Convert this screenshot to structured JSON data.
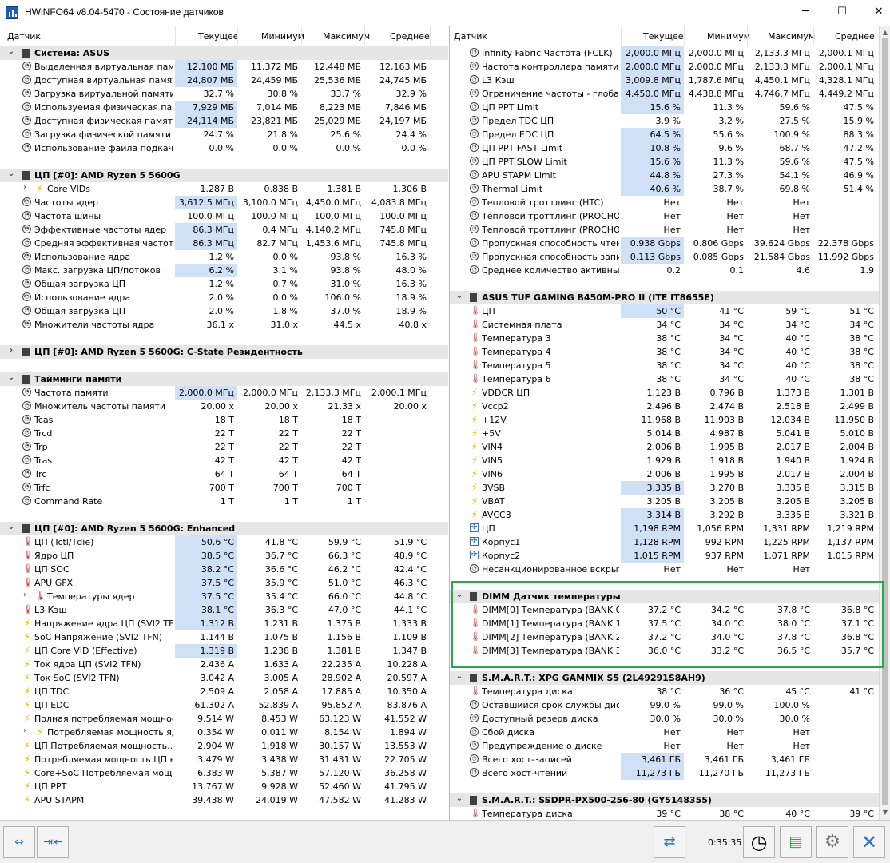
{
  "window": {
    "title": "HWiNFO64 v8.04-5470 - Состояние датчиков"
  },
  "columns": {
    "sensor": "Датчик",
    "current": "Текущее",
    "min": "Минимум",
    "max": "Максимум",
    "avg": "Среднее"
  },
  "left_rows": [
    {
      "type": "group",
      "exp": "⌄",
      "icon": "chip",
      "label": "Система: ASUS"
    },
    {
      "icon": "clock",
      "label": "Выделенная виртуальная память",
      "cur": "12,100 МБ",
      "min": "11,372 МБ",
      "max": "12,448 МБ",
      "avg": "12,163 МБ",
      "hl": true
    },
    {
      "icon": "clock",
      "label": "Доступная виртуальная память",
      "cur": "24,807 МБ",
      "min": "24,459 МБ",
      "max": "25,536 МБ",
      "avg": "24,745 МБ",
      "hl": true
    },
    {
      "icon": "clock",
      "label": "Загрузка виртуальной памяти",
      "cur": "32.7 %",
      "min": "30.8 %",
      "max": "33.7 %",
      "avg": "32.9 %"
    },
    {
      "icon": "clock",
      "label": "Используемая физическая память",
      "cur": "7,929 МБ",
      "min": "7,014 МБ",
      "max": "8,223 МБ",
      "avg": "7,846 МБ",
      "hl": true
    },
    {
      "icon": "clock",
      "label": "Доступная физическая память",
      "cur": "24,114 МБ",
      "min": "23,821 МБ",
      "max": "25,029 МБ",
      "avg": "24,197 МБ",
      "hl": true
    },
    {
      "icon": "clock",
      "label": "Загрузка физической памяти",
      "cur": "24.7 %",
      "min": "21.8 %",
      "max": "25.6 %",
      "avg": "24.4 %"
    },
    {
      "icon": "clock",
      "label": "Использование файла подкачки",
      "cur": "0.0 %",
      "min": "0.0 %",
      "max": "0.0 %",
      "avg": "0.0 %"
    },
    {
      "type": "spacer"
    },
    {
      "type": "group",
      "exp": "⌄",
      "icon": "chip",
      "label": "ЦП [#0]: AMD Ryzen 5 5600G"
    },
    {
      "exp": "›",
      "indent": 1,
      "icon": "bolt",
      "label": "Core VIDs",
      "cur": "1.287 В",
      "min": "0.838 В",
      "max": "1.381 В",
      "avg": "1.306 В"
    },
    {
      "exp": "›",
      "icon": "clock",
      "label": "Частоты ядер",
      "cur": "3,612.5 МГц",
      "min": "3,100.0 МГц",
      "max": "4,450.0 МГц",
      "avg": "4,083.8 МГц",
      "hl": true
    },
    {
      "icon": "clock",
      "label": "Частота шины",
      "cur": "100.0 МГц",
      "min": "100.0 МГц",
      "max": "100.0 МГц",
      "avg": "100.0 МГц"
    },
    {
      "exp": "›",
      "icon": "clock",
      "label": "Эффективные частоты ядер",
      "cur": "86.3 МГц",
      "min": "0.4 МГц",
      "max": "4,140.2 МГц",
      "avg": "745.8 МГц",
      "hl": true
    },
    {
      "icon": "clock",
      "label": "Средняя эффективная частота",
      "cur": "86.3 МГц",
      "min": "82.7 МГц",
      "max": "1,453.6 МГц",
      "avg": "745.8 МГц",
      "hl": true
    },
    {
      "exp": "›",
      "icon": "clock",
      "label": "Использование ядра",
      "cur": "1.2 %",
      "min": "0.0 %",
      "max": "93.8 %",
      "avg": "16.3 %"
    },
    {
      "icon": "clock",
      "label": "Макс. загрузка ЦП/потоков",
      "cur": "6.2 %",
      "min": "3.1 %",
      "max": "93.8 %",
      "avg": "48.0 %",
      "hl": true
    },
    {
      "icon": "clock",
      "label": "Общая загрузка ЦП",
      "cur": "1.2 %",
      "min": "0.7 %",
      "max": "31.0 %",
      "avg": "16.3 %"
    },
    {
      "exp": "›",
      "icon": "clock",
      "label": "Использование ядра",
      "cur": "2.0 %",
      "min": "0.0 %",
      "max": "106.0 %",
      "avg": "18.9 %"
    },
    {
      "icon": "clock",
      "label": "Общая загрузка ЦП",
      "cur": "2.0 %",
      "min": "1.8 %",
      "max": "37.0 %",
      "avg": "18.9 %"
    },
    {
      "exp": "›",
      "icon": "clock",
      "label": "Множители частоты ядра",
      "cur": "36.1 x",
      "min": "31.0 x",
      "max": "44.5 x",
      "avg": "40.8 x"
    },
    {
      "type": "spacer"
    },
    {
      "type": "group",
      "exp": "›",
      "icon": "chip",
      "label": "ЦП [#0]: AMD Ryzen 5 5600G: C-State Резидентность"
    },
    {
      "type": "spacer"
    },
    {
      "type": "group",
      "exp": "⌄",
      "icon": "chip",
      "label": "Тайминги памяти"
    },
    {
      "icon": "clock",
      "label": "Частота памяти",
      "cur": "2,000.0 МГц",
      "min": "2,000.0 МГц",
      "max": "2,133.3 МГц",
      "avg": "2,000.1 МГц",
      "hl": true
    },
    {
      "icon": "clock",
      "label": "Множитель частоты памяти",
      "cur": "20.00 x",
      "min": "20.00 x",
      "max": "21.33 x",
      "avg": "20.00 x"
    },
    {
      "icon": "clock",
      "label": "Tcas",
      "cur": "18 T",
      "min": "18 T",
      "max": "18 T",
      "avg": ""
    },
    {
      "icon": "clock",
      "label": "Trcd",
      "cur": "22 T",
      "min": "22 T",
      "max": "22 T",
      "avg": ""
    },
    {
      "icon": "clock",
      "label": "Trp",
      "cur": "22 T",
      "min": "22 T",
      "max": "22 T",
      "avg": ""
    },
    {
      "icon": "clock",
      "label": "Tras",
      "cur": "42 T",
      "min": "42 T",
      "max": "42 T",
      "avg": ""
    },
    {
      "icon": "clock",
      "label": "Trc",
      "cur": "64 T",
      "min": "64 T",
      "max": "64 T",
      "avg": ""
    },
    {
      "icon": "clock",
      "label": "Trfc",
      "cur": "700 T",
      "min": "700 T",
      "max": "700 T",
      "avg": ""
    },
    {
      "icon": "clock",
      "label": "Command Rate",
      "cur": "1 T",
      "min": "1 T",
      "max": "1 T",
      "avg": ""
    },
    {
      "type": "spacer"
    },
    {
      "type": "group",
      "exp": "⌄",
      "icon": "chip",
      "label": "ЦП [#0]: AMD Ryzen 5 5600G: Enhanced"
    },
    {
      "icon": "therm",
      "label": "ЦП (Tctl/Tdie)",
      "cur": "50.6 °C",
      "min": "41.8 °C",
      "max": "59.9 °C",
      "avg": "51.9 °C",
      "hl": true
    },
    {
      "icon": "therm",
      "label": "Ядро ЦП",
      "cur": "38.5 °C",
      "min": "36.7 °C",
      "max": "66.3 °C",
      "avg": "48.9 °C",
      "hl": true
    },
    {
      "icon": "therm",
      "label": "ЦП SOC",
      "cur": "38.2 °C",
      "min": "36.6 °C",
      "max": "46.2 °C",
      "avg": "42.4 °C",
      "hl": true
    },
    {
      "icon": "therm",
      "label": "APU GFX",
      "cur": "37.5 °C",
      "min": "35.9 °C",
      "max": "51.0 °C",
      "avg": "46.3 °C",
      "hl": true
    },
    {
      "exp": "›",
      "indent": 1,
      "icon": "therm",
      "label": "Температуры ядер",
      "cur": "37.5 °C",
      "min": "35.4 °C",
      "max": "66.0 °C",
      "avg": "44.8 °C",
      "hl": true
    },
    {
      "icon": "therm",
      "label": "L3 Кэш",
      "cur": "38.1 °C",
      "min": "36.3 °C",
      "max": "47.0 °C",
      "avg": "44.1 °C",
      "hl": true
    },
    {
      "icon": "bolt",
      "label": "Напряжение ядра ЦП (SVI2 TFN)",
      "cur": "1.312 В",
      "min": "1.231 В",
      "max": "1.375 В",
      "avg": "1.333 В",
      "hl": true
    },
    {
      "icon": "bolt",
      "label": "SoC Напряжение (SVI2 TFN)",
      "cur": "1.144 В",
      "min": "1.075 В",
      "max": "1.156 В",
      "avg": "1.109 В"
    },
    {
      "icon": "bolt",
      "label": "ЦП Core VID (Effective)",
      "cur": "1.319 В",
      "min": "1.238 В",
      "max": "1.381 В",
      "avg": "1.347 В",
      "hl": true
    },
    {
      "icon": "bolt",
      "label": "Ток ядра ЦП (SVI2 TFN)",
      "cur": "2.436 A",
      "min": "1.633 A",
      "max": "22.235 A",
      "avg": "10.228 A"
    },
    {
      "icon": "bolt",
      "label": "Ток SoC (SVI2 TFN)",
      "cur": "3.042 A",
      "min": "3.005 A",
      "max": "28.902 A",
      "avg": "20.597 A"
    },
    {
      "icon": "bolt",
      "label": "ЦП TDC",
      "cur": "2.509 A",
      "min": "2.058 A",
      "max": "17.885 A",
      "avg": "10.350 A"
    },
    {
      "icon": "bolt",
      "label": "ЦП EDC",
      "cur": "61.302 A",
      "min": "52.839 A",
      "max": "95.852 A",
      "avg": "83.876 A"
    },
    {
      "icon": "bolt",
      "label": "Полная потребляемая мощност...",
      "cur": "9.514 W",
      "min": "8.453 W",
      "max": "63.123 W",
      "avg": "41.552 W"
    },
    {
      "exp": "›",
      "indent": 1,
      "icon": "bolt",
      "label": "Потребляемая мощность ядер",
      "cur": "0.354 W",
      "min": "0.011 W",
      "max": "8.154 W",
      "avg": "1.894 W"
    },
    {
      "icon": "bolt",
      "label": "ЦП Потребляемая мощность...",
      "cur": "2.904 W",
      "min": "1.918 W",
      "max": "30.157 W",
      "avg": "13.553 W"
    },
    {
      "icon": "bolt",
      "label": "Потребляемая мощность ЦП на...",
      "cur": "3.479 W",
      "min": "3.438 W",
      "max": "31.431 W",
      "avg": "22.705 W"
    },
    {
      "icon": "bolt",
      "label": "Core+SoC Потребляемая мощн...",
      "cur": "6.383 W",
      "min": "5.387 W",
      "max": "57.120 W",
      "avg": "36.258 W"
    },
    {
      "icon": "bolt",
      "label": "ЦП PPT",
      "cur": "13.767 W",
      "min": "9.928 W",
      "max": "52.460 W",
      "avg": "41.795 W"
    },
    {
      "icon": "bolt",
      "label": "APU STAPM",
      "cur": "39.438 W",
      "min": "24.019 W",
      "max": "47.582 W",
      "avg": "41.283 W"
    }
  ],
  "right_rows": [
    {
      "icon": "clock",
      "label": "Infinity Fabric Частота (FCLK)",
      "cur": "2,000.0 МГц",
      "min": "2,000.0 МГц",
      "max": "2,133.3 МГц",
      "avg": "2,000.1 МГц",
      "hl": true
    },
    {
      "icon": "clock",
      "label": "Частота контроллера памяти (...",
      "cur": "2,000.0 МГц",
      "min": "2,000.0 МГц",
      "max": "2,133.3 МГц",
      "avg": "2,000.1 МГц",
      "hl": true
    },
    {
      "icon": "clock",
      "label": "L3 Кэш",
      "cur": "3,009.8 МГц",
      "min": "1,787.6 МГц",
      "max": "4,450.1 МГц",
      "avg": "4,328.1 МГц",
      "hl": true
    },
    {
      "icon": "clock",
      "label": "Ограничение частоты - глобал...",
      "cur": "4,450.0 МГц",
      "min": "4,438.8 МГц",
      "max": "4,746.7 МГц",
      "avg": "4,449.2 МГц",
      "hl": true
    },
    {
      "icon": "clock",
      "label": "ЦП PPT Limit",
      "cur": "15.6 %",
      "min": "11.3 %",
      "max": "59.6 %",
      "avg": "47.5 %",
      "hl": true
    },
    {
      "icon": "clock",
      "label": "Предел TDC ЦП",
      "cur": "3.9 %",
      "min": "3.2 %",
      "max": "27.5 %",
      "avg": "15.9 %"
    },
    {
      "icon": "clock",
      "label": "Предел EDC ЦП",
      "cur": "64.5 %",
      "min": "55.6 %",
      "max": "100.9 %",
      "avg": "88.3 %",
      "hl": true
    },
    {
      "icon": "clock",
      "label": "ЦП PPT FAST Limit",
      "cur": "10.8 %",
      "min": "9.6 %",
      "max": "68.7 %",
      "avg": "47.2 %",
      "hl": true
    },
    {
      "icon": "clock",
      "label": "ЦП PPT SLOW Limit",
      "cur": "15.6 %",
      "min": "11.3 %",
      "max": "59.6 %",
      "avg": "47.5 %",
      "hl": true
    },
    {
      "icon": "clock",
      "label": "APU STAPM Limit",
      "cur": "44.8 %",
      "min": "27.3 %",
      "max": "54.1 %",
      "avg": "46.9 %",
      "hl": true
    },
    {
      "icon": "clock",
      "label": "Thermal Limit",
      "cur": "40.6 %",
      "min": "38.7 %",
      "max": "69.8 %",
      "avg": "51.4 %",
      "hl": true
    },
    {
      "icon": "clock",
      "label": "Тепловой троттлинг (HTC)",
      "cur": "Нет",
      "min": "Нет",
      "max": "Нет",
      "avg": ""
    },
    {
      "icon": "clock",
      "label": "Тепловой троттлинг (PROCHOT...",
      "cur": "Нет",
      "min": "Нет",
      "max": "Нет",
      "avg": ""
    },
    {
      "icon": "clock",
      "label": "Тепловой троттлинг (PROCHOT...",
      "cur": "Нет",
      "min": "Нет",
      "max": "Нет",
      "avg": ""
    },
    {
      "icon": "clock",
      "label": "Пропускная способность чтени...",
      "cur": "0.938 Gbps",
      "min": "0.806 Gbps",
      "max": "39.624 Gbps",
      "avg": "22.378 Gbps",
      "hl": true
    },
    {
      "icon": "clock",
      "label": "Пропускная способность запис...",
      "cur": "0.113 Gbps",
      "min": "0.085 Gbps",
      "max": "21.584 Gbps",
      "avg": "11.992 Gbps",
      "hl": true
    },
    {
      "icon": "clock",
      "label": "Среднее количество активных...",
      "cur": "0.2",
      "min": "0.1",
      "max": "4.6",
      "avg": "1.9"
    },
    {
      "type": "spacer"
    },
    {
      "type": "group",
      "exp": "⌄",
      "icon": "chip",
      "label": "ASUS TUF GAMING B450M-PRO II (ITE IT8655E)"
    },
    {
      "icon": "therm",
      "label": "ЦП",
      "cur": "50 °C",
      "min": "41 °C",
      "max": "59 °C",
      "avg": "51 °C",
      "hl": true
    },
    {
      "icon": "therm",
      "label": "Системная плата",
      "cur": "34 °C",
      "min": "34 °C",
      "max": "34 °C",
      "avg": "34 °C"
    },
    {
      "icon": "therm",
      "label": "Температура 3",
      "cur": "38 °C",
      "min": "34 °C",
      "max": "40 °C",
      "avg": "38 °C"
    },
    {
      "icon": "therm",
      "label": "Температура 4",
      "cur": "38 °C",
      "min": "34 °C",
      "max": "40 °C",
      "avg": "38 °C"
    },
    {
      "icon": "therm",
      "label": "Температура 5",
      "cur": "38 °C",
      "min": "34 °C",
      "max": "40 °C",
      "avg": "38 °C"
    },
    {
      "icon": "therm",
      "label": "Температура 6",
      "cur": "38 °C",
      "min": "34 °C",
      "max": "40 °C",
      "avg": "38 °C"
    },
    {
      "icon": "bolt",
      "label": "VDDCR ЦП",
      "cur": "1.123 В",
      "min": "0.796 В",
      "max": "1.373 В",
      "avg": "1.301 В"
    },
    {
      "icon": "bolt",
      "label": "Vccp2",
      "cur": "2.496 В",
      "min": "2.474 В",
      "max": "2.518 В",
      "avg": "2.499 В"
    },
    {
      "icon": "bolt",
      "label": "+12V",
      "cur": "11.968 В",
      "min": "11.903 В",
      "max": "12.034 В",
      "avg": "11.950 В"
    },
    {
      "icon": "bolt",
      "label": "+5V",
      "cur": "5.014 В",
      "min": "4.987 В",
      "max": "5.041 В",
      "avg": "5.010 В"
    },
    {
      "icon": "bolt",
      "label": "VIN4",
      "cur": "2.006 В",
      "min": "1.995 В",
      "max": "2.017 В",
      "avg": "2.004 В"
    },
    {
      "icon": "bolt",
      "label": "VIN5",
      "cur": "1.929 В",
      "min": "1.918 В",
      "max": "1.940 В",
      "avg": "1.924 В"
    },
    {
      "icon": "bolt",
      "label": "VIN6",
      "cur": "2.006 В",
      "min": "1.995 В",
      "max": "2.017 В",
      "avg": "2.004 В"
    },
    {
      "icon": "bolt",
      "label": "3VSB",
      "cur": "3.335 В",
      "min": "3.270 В",
      "max": "3.335 В",
      "avg": "3.315 В",
      "hl": true
    },
    {
      "icon": "bolt",
      "label": "VBAT",
      "cur": "3.205 В",
      "min": "3.205 В",
      "max": "3.205 В",
      "avg": "3.205 В"
    },
    {
      "icon": "bolt",
      "label": "AVCC3",
      "cur": "3.314 В",
      "min": "3.292 В",
      "max": "3.335 В",
      "avg": "3.321 В",
      "hl": true
    },
    {
      "icon": "fan",
      "label": "ЦП",
      "cur": "1,198 RPM",
      "min": "1,056 RPM",
      "max": "1,331 RPM",
      "avg": "1,219 RPM",
      "hl": true
    },
    {
      "icon": "fan",
      "label": "Корпус1",
      "cur": "1,128 RPM",
      "min": "992 RPM",
      "max": "1,225 RPM",
      "avg": "1,137 RPM",
      "hl": true
    },
    {
      "icon": "fan",
      "label": "Корпус2",
      "cur": "1,015 RPM",
      "min": "937 RPM",
      "max": "1,071 RPM",
      "avg": "1,015 RPM",
      "hl": true
    },
    {
      "icon": "clock",
      "label": "Несанкционированное вскрыти...",
      "cur": "Нет",
      "min": "Нет",
      "max": "Нет",
      "avg": ""
    },
    {
      "type": "spacer"
    },
    {
      "type": "group",
      "exp": "⌄",
      "icon": "chip",
      "label": "DIMM Датчик температуры"
    },
    {
      "icon": "therm",
      "label": "DIMM[0] Температура (BANK 0/...",
      "cur": "37.2 °C",
      "min": "34.2 °C",
      "max": "37.8 °C",
      "avg": "36.8 °C"
    },
    {
      "icon": "therm",
      "label": "DIMM[1] Температура (BANK 1/...",
      "cur": "37.5 °C",
      "min": "34.0 °C",
      "max": "38.0 °C",
      "avg": "37.1 °C"
    },
    {
      "icon": "therm",
      "label": "DIMM[2] Температура (BANK 2/...",
      "cur": "37.2 °C",
      "min": "34.0 °C",
      "max": "37.8 °C",
      "avg": "36.8 °C"
    },
    {
      "icon": "therm",
      "label": "DIMM[3] Температура (BANK 3/...",
      "cur": "36.0 °C",
      "min": "33.2 °C",
      "max": "36.5 °C",
      "avg": "35.7 °C"
    },
    {
      "type": "spacer"
    },
    {
      "type": "group",
      "exp": "⌄",
      "icon": "chip",
      "label": "S.M.A.R.T.: XPG GAMMIX S5 (2L49291S8AH9)"
    },
    {
      "icon": "therm",
      "label": "Температура диска",
      "cur": "38 °C",
      "min": "36 °C",
      "max": "45 °C",
      "avg": "41 °C"
    },
    {
      "icon": "clock",
      "label": "Оставшийся срок службы диска",
      "cur": "99.0 %",
      "min": "99.0 %",
      "max": "100.0 %",
      "avg": ""
    },
    {
      "icon": "clock",
      "label": "Доступный резерв диска",
      "cur": "30.0 %",
      "min": "30.0 %",
      "max": "30.0 %",
      "avg": ""
    },
    {
      "icon": "clock",
      "label": "Сбой диска",
      "cur": "Нет",
      "min": "Нет",
      "max": "Нет",
      "avg": ""
    },
    {
      "icon": "clock",
      "label": "Предупреждение о диске",
      "cur": "Нет",
      "min": "Нет",
      "max": "Нет",
      "avg": ""
    },
    {
      "icon": "clock",
      "label": "Всего хост-записей",
      "cur": "3,461 ГБ",
      "min": "3,461 ГБ",
      "max": "3,461 ГБ",
      "avg": "",
      "hl": true
    },
    {
      "icon": "clock",
      "label": "Всего хост-чтений",
      "cur": "11,273 ГБ",
      "min": "11,270 ГБ",
      "max": "11,273 ГБ",
      "avg": "",
      "hl": true
    },
    {
      "type": "spacer"
    },
    {
      "type": "group",
      "exp": "⌄",
      "icon": "chip",
      "label": "S.M.A.R.T.: SSDPR-PX500-256-80 (GY5148355)"
    },
    {
      "icon": "therm",
      "label": "Температура диска",
      "cur": "39 °C",
      "min": "38 °C",
      "max": "40 °C",
      "avg": "39 °C"
    }
  ],
  "status": {
    "elapsed": "0:35:35"
  },
  "icons": {
    "row_icons": [
      "clock-icon",
      "thermometer-icon",
      "voltage-bolt-icon",
      "fan-icon",
      "chip-icon"
    ],
    "statusbar": [
      "nav-left-right-icon",
      "nav-collapse-icon",
      "network-icon",
      "clock-icon",
      "add-report-icon",
      "settings-gear-icon",
      "close-x-icon"
    ]
  },
  "colors": {
    "highlight": "#cfe0f7",
    "group_bg": "#e6e6e6",
    "green_frame": "#2aa84a"
  }
}
